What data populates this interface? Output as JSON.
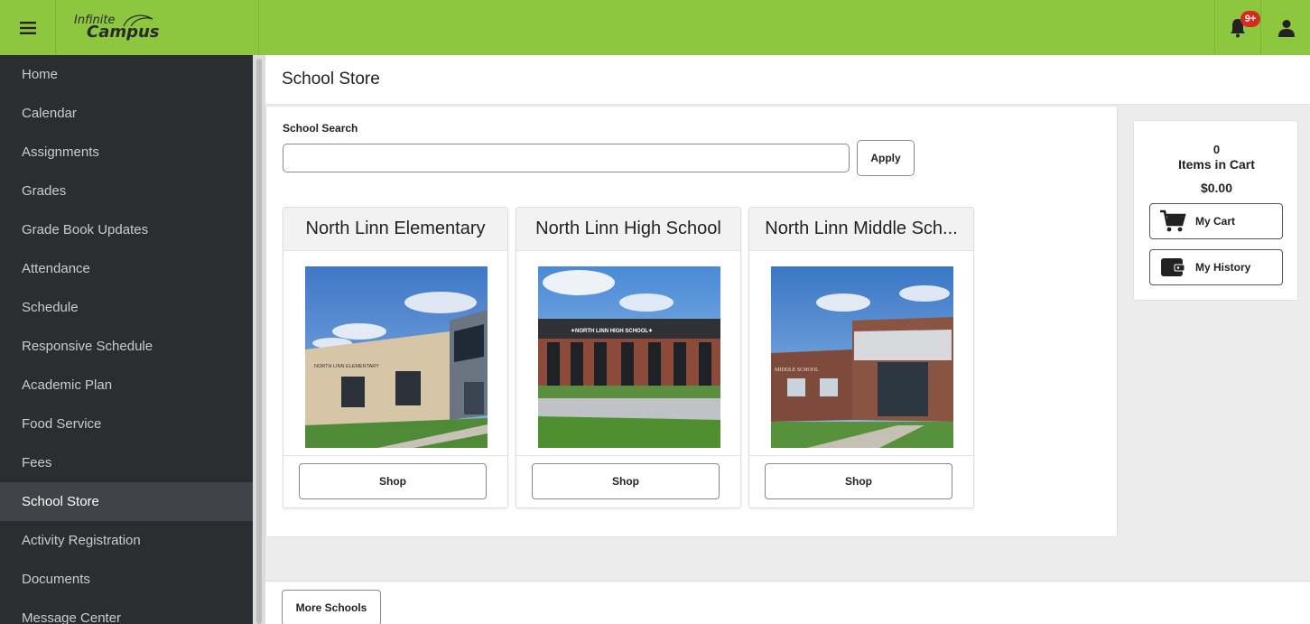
{
  "header": {
    "logo_line1": "Infinite",
    "logo_line2": "Campus",
    "notification_badge": "9+",
    "accent_color": "#8dc63f"
  },
  "sidebar": {
    "items": [
      {
        "label": "Home"
      },
      {
        "label": "Calendar"
      },
      {
        "label": "Assignments"
      },
      {
        "label": "Grades"
      },
      {
        "label": "Grade Book Updates"
      },
      {
        "label": "Attendance"
      },
      {
        "label": "Schedule"
      },
      {
        "label": "Responsive Schedule"
      },
      {
        "label": "Academic Plan"
      },
      {
        "label": "Food Service"
      },
      {
        "label": "Fees"
      },
      {
        "label": "School Store"
      },
      {
        "label": "Activity Registration"
      },
      {
        "label": "Documents"
      },
      {
        "label": "Message Center"
      }
    ],
    "active_item": "School Store"
  },
  "page": {
    "title": "School Store"
  },
  "search": {
    "label": "School Search",
    "value": "",
    "placeholder": "",
    "apply_label": "Apply"
  },
  "schools": [
    {
      "name": "North Linn Elementary",
      "sign_text": "NORTH LINN ELEMENTARY",
      "shop_label": "Shop"
    },
    {
      "name": "North Linn High School",
      "sign_text": "✦NORTH LINN HIGH SCHOOL✦",
      "shop_label": "Shop"
    },
    {
      "name": "North Linn Middle Sch...",
      "sign_text": "MIDDLE SCHOOL",
      "shop_label": "Shop"
    }
  ],
  "cart": {
    "count": "0",
    "items_label": "Items in Cart",
    "total": "$0.00",
    "my_cart_label": "My Cart",
    "my_history_label": "My History"
  },
  "footer": {
    "more_schools_label": "More Schools"
  }
}
